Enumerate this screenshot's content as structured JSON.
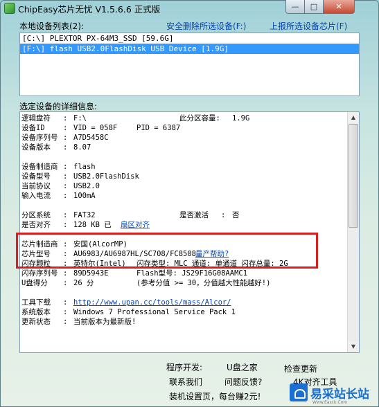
{
  "window": {
    "title": "ChipEasy芯片无忧 V1.5.6.6 正式版",
    "controls": {
      "minimize": "—",
      "maximize": "□",
      "close": "✕"
    }
  },
  "device_list": {
    "label": "本地设备列表(2):",
    "remove_link": "安全删除所选设备(F:)",
    "report_link": "上报所选设备芯片(F)",
    "items": [
      {
        "text": "[C:\\] PLEXTOR PX-64M3_SSD [59.6G]",
        "selected": false
      },
      {
        "text": "[F:\\] flash USB2.0FlashDisk USB Device [1.9G]",
        "selected": true
      }
    ]
  },
  "details": {
    "label": "选定设备的详细信息:",
    "rows": [
      {
        "k": "逻辑盘符",
        "s": ":",
        "v": "F:\\",
        "k2": "此分区容量:",
        "v2": "1.9G"
      },
      {
        "k": "设备ID",
        "s": ":",
        "v": "VID = 058F",
        "k2": "PID = 6387"
      },
      {
        "k": "设备序列号",
        "s": ":",
        "v": "A7D5458C"
      },
      {
        "k": "设备版本",
        "s": ":",
        "v": "8.07"
      },
      {
        "k": "设备制造商",
        "s": ":",
        "v": "flash"
      },
      {
        "k": "设备型号",
        "s": ":",
        "v": "USB2.0FlashDisk"
      },
      {
        "k": "当前协议",
        "s": ":",
        "v": "USB2.0"
      },
      {
        "k": "输入电流",
        "s": ":",
        "v": "100mA"
      },
      {
        "k": "分区系统",
        "s": ":",
        "v": "FAT32",
        "k2": "是否激活",
        "s2": ":",
        "v2": "否"
      },
      {
        "k": "是否对齐",
        "s": ":",
        "v": "128 KB 已",
        "link": "扇区对齐"
      },
      {
        "k": "芯片制造商",
        "s": ":",
        "v": "安国(AlcorMP)"
      },
      {
        "k": "芯片型号",
        "s": ":",
        "v": "AU6983/AU6987HL/SC708/FC8508",
        "link": "量产帮助?"
      },
      {
        "k": "闪存颗粒",
        "s": ":",
        "v": "英特尔(Intel)",
        "k2": "闪存类型: MLC  通道: 单通道  闪存总量: 2G"
      },
      {
        "k": "闪存序列号",
        "s": ":",
        "v": "89D5943E",
        "k2": "Flash型号: JS29F16G08AAMC1"
      },
      {
        "k": "U盘得分",
        "s": ":",
        "v": "26 分",
        "k2": "(参考分值 >= 30，分值越大性能越好!)"
      },
      {
        "k": "工具下载",
        "s": ":",
        "link": "http://www.upan.cc/tools/mass/Alcor/"
      },
      {
        "k": "系统版本",
        "s": ":",
        "v": "Windows 7 Professional Service Pack 1"
      },
      {
        "k": "更新状态",
        "s": ":",
        "v": "当前版本为最新版!"
      }
    ]
  },
  "footer": {
    "dev_label": "程序开发:",
    "site": "U盘之家",
    "update": "检查更新",
    "contact": "联系我们",
    "feedback": "问题反馈?",
    "tool": "4K对齐工具",
    "nav": "装机设置页，每台赚2元!"
  },
  "watermark": {
    "text": "易采站长站",
    "sub": "Www.Easck.Com"
  }
}
